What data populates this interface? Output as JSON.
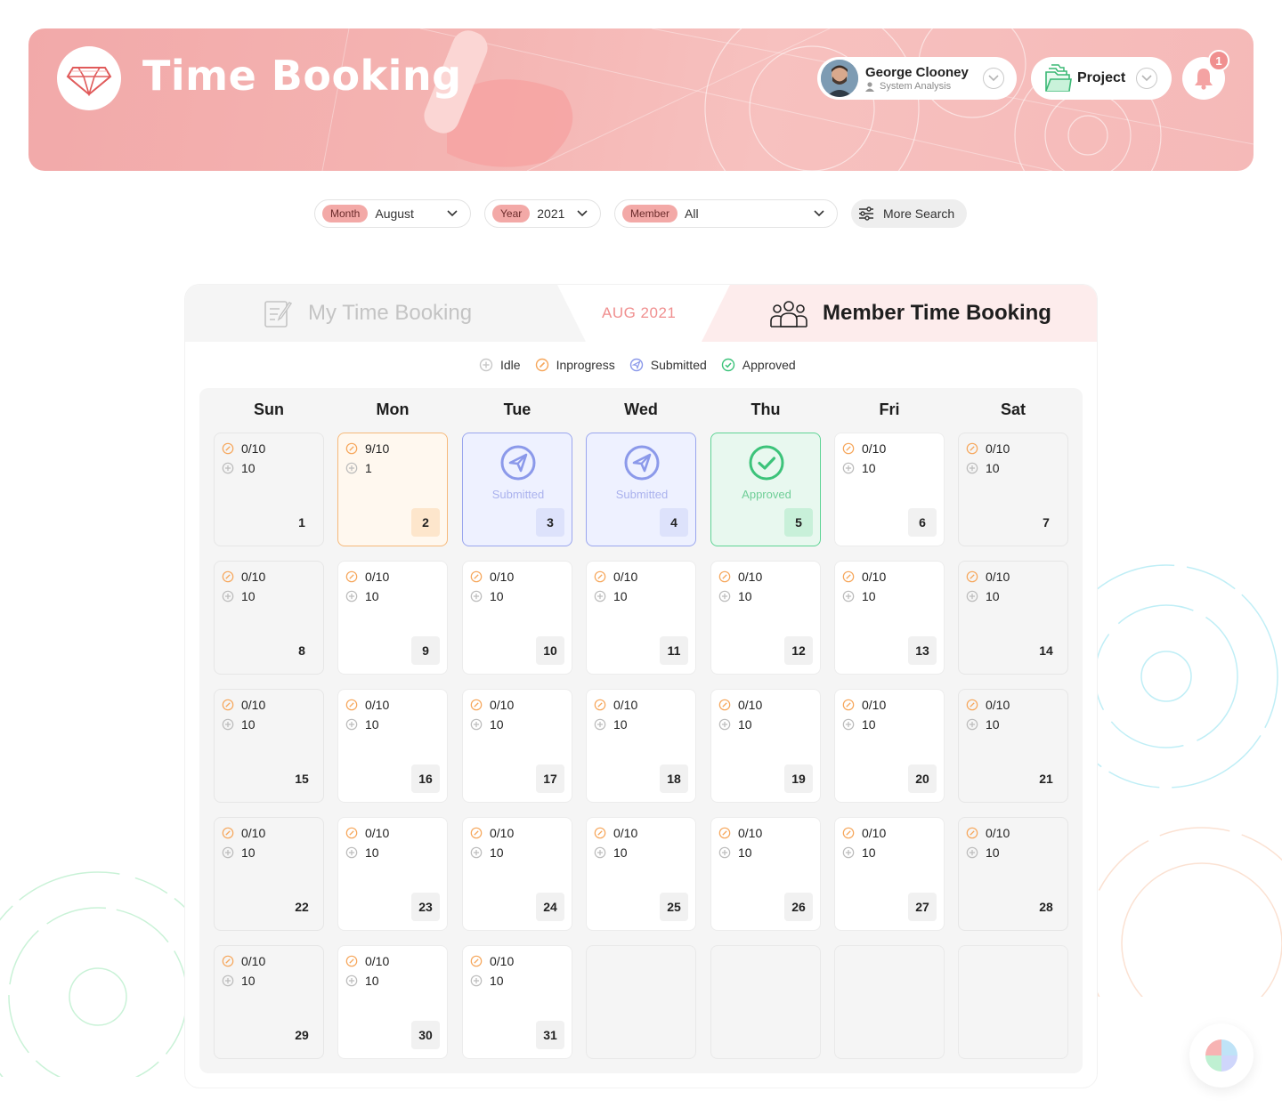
{
  "header": {
    "app_title": "Time Booking",
    "user": {
      "name": "George Clooney",
      "role": "System Analysis"
    },
    "project_label": "Project",
    "notification_count": "1"
  },
  "filters": {
    "month": {
      "tag": "Month",
      "value": "August"
    },
    "year": {
      "tag": "Year",
      "value": "2021"
    },
    "member": {
      "tag": "Member",
      "value": "All"
    },
    "more_search_label": "More Search"
  },
  "tabs": {
    "my_label": "My Time Booking",
    "current_month": "AUG 2021",
    "member_label": "Member Time Booking",
    "active": "member"
  },
  "legend": [
    "Idle",
    "Inprogress",
    "Submitted",
    "Approved"
  ],
  "weekdays": [
    "Sun",
    "Mon",
    "Tue",
    "Wed",
    "Thu",
    "Fri",
    "Sat"
  ],
  "colors": {
    "accent": "#f08f8f",
    "inprogress": "#f6a65a",
    "submitted": "#8b99ea",
    "approved": "#3cc37a",
    "idle": "#c8c8c8"
  },
  "days": [
    {
      "day": "1",
      "progress": "0/10",
      "idle": "10",
      "status": "normal"
    },
    {
      "day": "2",
      "progress": "9/10",
      "idle": "1",
      "status": "inprogress"
    },
    {
      "day": "3",
      "status": "submitted",
      "status_label": "Submitted"
    },
    {
      "day": "4",
      "status": "submitted",
      "status_label": "Submitted"
    },
    {
      "day": "5",
      "status": "approved",
      "status_label": "Approved"
    },
    {
      "day": "6",
      "progress": "0/10",
      "idle": "10",
      "status": "normal"
    },
    {
      "day": "7",
      "progress": "0/10",
      "idle": "10",
      "status": "normal"
    },
    {
      "day": "8",
      "progress": "0/10",
      "idle": "10",
      "status": "normal"
    },
    {
      "day": "9",
      "progress": "0/10",
      "idle": "10",
      "status": "normal"
    },
    {
      "day": "10",
      "progress": "0/10",
      "idle": "10",
      "status": "normal"
    },
    {
      "day": "11",
      "progress": "0/10",
      "idle": "10",
      "status": "normal"
    },
    {
      "day": "12",
      "progress": "0/10",
      "idle": "10",
      "status": "normal"
    },
    {
      "day": "13",
      "progress": "0/10",
      "idle": "10",
      "status": "normal"
    },
    {
      "day": "14",
      "progress": "0/10",
      "idle": "10",
      "status": "normal"
    },
    {
      "day": "15",
      "progress": "0/10",
      "idle": "10",
      "status": "normal"
    },
    {
      "day": "16",
      "progress": "0/10",
      "idle": "10",
      "status": "normal"
    },
    {
      "day": "17",
      "progress": "0/10",
      "idle": "10",
      "status": "normal"
    },
    {
      "day": "18",
      "progress": "0/10",
      "idle": "10",
      "status": "normal"
    },
    {
      "day": "19",
      "progress": "0/10",
      "idle": "10",
      "status": "normal"
    },
    {
      "day": "20",
      "progress": "0/10",
      "idle": "10",
      "status": "normal"
    },
    {
      "day": "21",
      "progress": "0/10",
      "idle": "10",
      "status": "normal"
    },
    {
      "day": "22",
      "progress": "0/10",
      "idle": "10",
      "status": "normal"
    },
    {
      "day": "23",
      "progress": "0/10",
      "idle": "10",
      "status": "normal"
    },
    {
      "day": "24",
      "progress": "0/10",
      "idle": "10",
      "status": "normal"
    },
    {
      "day": "25",
      "progress": "0/10",
      "idle": "10",
      "status": "normal"
    },
    {
      "day": "26",
      "progress": "0/10",
      "idle": "10",
      "status": "normal"
    },
    {
      "day": "27",
      "progress": "0/10",
      "idle": "10",
      "status": "normal"
    },
    {
      "day": "28",
      "progress": "0/10",
      "idle": "10",
      "status": "normal"
    },
    {
      "day": "29",
      "progress": "0/10",
      "idle": "10",
      "status": "normal"
    },
    {
      "day": "30",
      "progress": "0/10",
      "idle": "10",
      "status": "normal"
    },
    {
      "day": "31",
      "progress": "0/10",
      "idle": "10",
      "status": "normal"
    }
  ]
}
